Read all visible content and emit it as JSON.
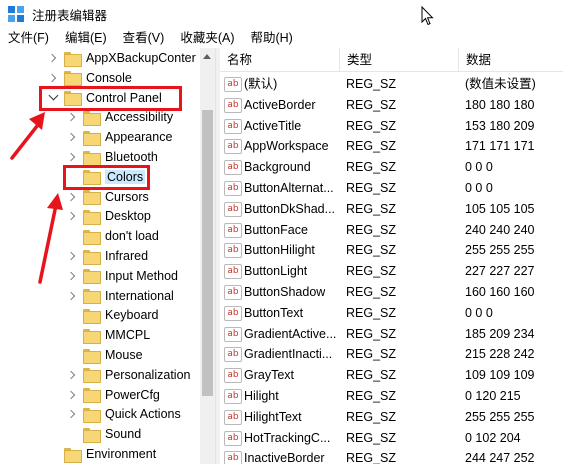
{
  "window": {
    "title": "注册表编辑器"
  },
  "menu": [
    "文件(F)",
    "编辑(E)",
    "查看(V)",
    "收藏夹(A)",
    "帮助(H)"
  ],
  "tree": [
    {
      "label": "AppXBackupConter",
      "chevron": "right"
    },
    {
      "label": "Console",
      "chevron": "right"
    },
    {
      "label": "Control Panel",
      "chevron": "down"
    },
    {
      "label": "Accessibility",
      "chevron": "right"
    },
    {
      "label": "Appearance",
      "chevron": "right"
    },
    {
      "label": "Bluetooth",
      "chevron": "right"
    },
    {
      "label": "Colors",
      "chevron": "none",
      "selected": true
    },
    {
      "label": "Cursors",
      "chevron": "right"
    },
    {
      "label": "Desktop",
      "chevron": "right"
    },
    {
      "label": "don't load",
      "chevron": "none"
    },
    {
      "label": "Infrared",
      "chevron": "right"
    },
    {
      "label": "Input Method",
      "chevron": "right"
    },
    {
      "label": "International",
      "chevron": "right"
    },
    {
      "label": "Keyboard",
      "chevron": "none"
    },
    {
      "label": "MMCPL",
      "chevron": "none"
    },
    {
      "label": "Mouse",
      "chevron": "none"
    },
    {
      "label": "Personalization",
      "chevron": "right"
    },
    {
      "label": "PowerCfg",
      "chevron": "right"
    },
    {
      "label": "Quick Actions",
      "chevron": "right"
    },
    {
      "label": "Sound",
      "chevron": "none"
    },
    {
      "label": "Environment",
      "chevron": "none"
    }
  ],
  "list": {
    "headers": {
      "name": "名称",
      "type": "类型",
      "data": "数据"
    },
    "icon_text": "ab",
    "rows": [
      {
        "name": "(默认)",
        "type": "REG_SZ",
        "data": "(数值未设置)"
      },
      {
        "name": "ActiveBorder",
        "type": "REG_SZ",
        "data": "180 180 180"
      },
      {
        "name": "ActiveTitle",
        "type": "REG_SZ",
        "data": "153 180 209"
      },
      {
        "name": "AppWorkspace",
        "type": "REG_SZ",
        "data": "171 171 171"
      },
      {
        "name": "Background",
        "type": "REG_SZ",
        "data": "0 0 0"
      },
      {
        "name": "ButtonAlternat...",
        "type": "REG_SZ",
        "data": "0 0 0"
      },
      {
        "name": "ButtonDkShad...",
        "type": "REG_SZ",
        "data": "105 105 105"
      },
      {
        "name": "ButtonFace",
        "type": "REG_SZ",
        "data": "240 240 240"
      },
      {
        "name": "ButtonHilight",
        "type": "REG_SZ",
        "data": "255 255 255"
      },
      {
        "name": "ButtonLight",
        "type": "REG_SZ",
        "data": "227 227 227"
      },
      {
        "name": "ButtonShadow",
        "type": "REG_SZ",
        "data": "160 160 160"
      },
      {
        "name": "ButtonText",
        "type": "REG_SZ",
        "data": "0 0 0"
      },
      {
        "name": "GradientActive...",
        "type": "REG_SZ",
        "data": "185 209 234"
      },
      {
        "name": "GradientInacti...",
        "type": "REG_SZ",
        "data": "215 228 242"
      },
      {
        "name": "GrayText",
        "type": "REG_SZ",
        "data": "109 109 109"
      },
      {
        "name": "Hilight",
        "type": "REG_SZ",
        "data": "0 120 215"
      },
      {
        "name": "HilightText",
        "type": "REG_SZ",
        "data": "255 255 255"
      },
      {
        "name": "HotTrackingC...",
        "type": "REG_SZ",
        "data": "0 102 204"
      },
      {
        "name": "InactiveBorder",
        "type": "REG_SZ",
        "data": "244 247 252"
      }
    ]
  },
  "colors": {
    "annotation_red": "#e8141c",
    "selection": "#cce8ff",
    "folder": "#f7d775"
  }
}
